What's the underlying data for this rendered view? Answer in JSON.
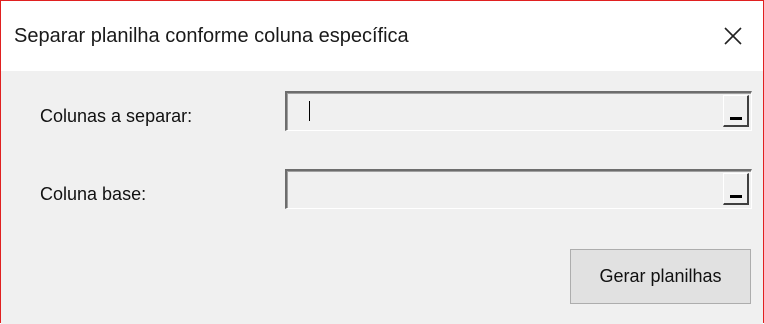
{
  "window": {
    "title": "Separar planilha conforme coluna específica",
    "close_icon": "close-icon"
  },
  "form": {
    "columns_label": "Colunas a separar:",
    "columns_value": "",
    "base_label": "Coluna base:",
    "base_value": "",
    "collapse_icon": "collapse-dialog-icon"
  },
  "actions": {
    "generate_label": "Gerar planilhas"
  },
  "colors": {
    "window_border": "#e02020",
    "client_background": "#f0f0f0",
    "titlebar_background": "#ffffff",
    "button_background": "#e1e1e1"
  }
}
